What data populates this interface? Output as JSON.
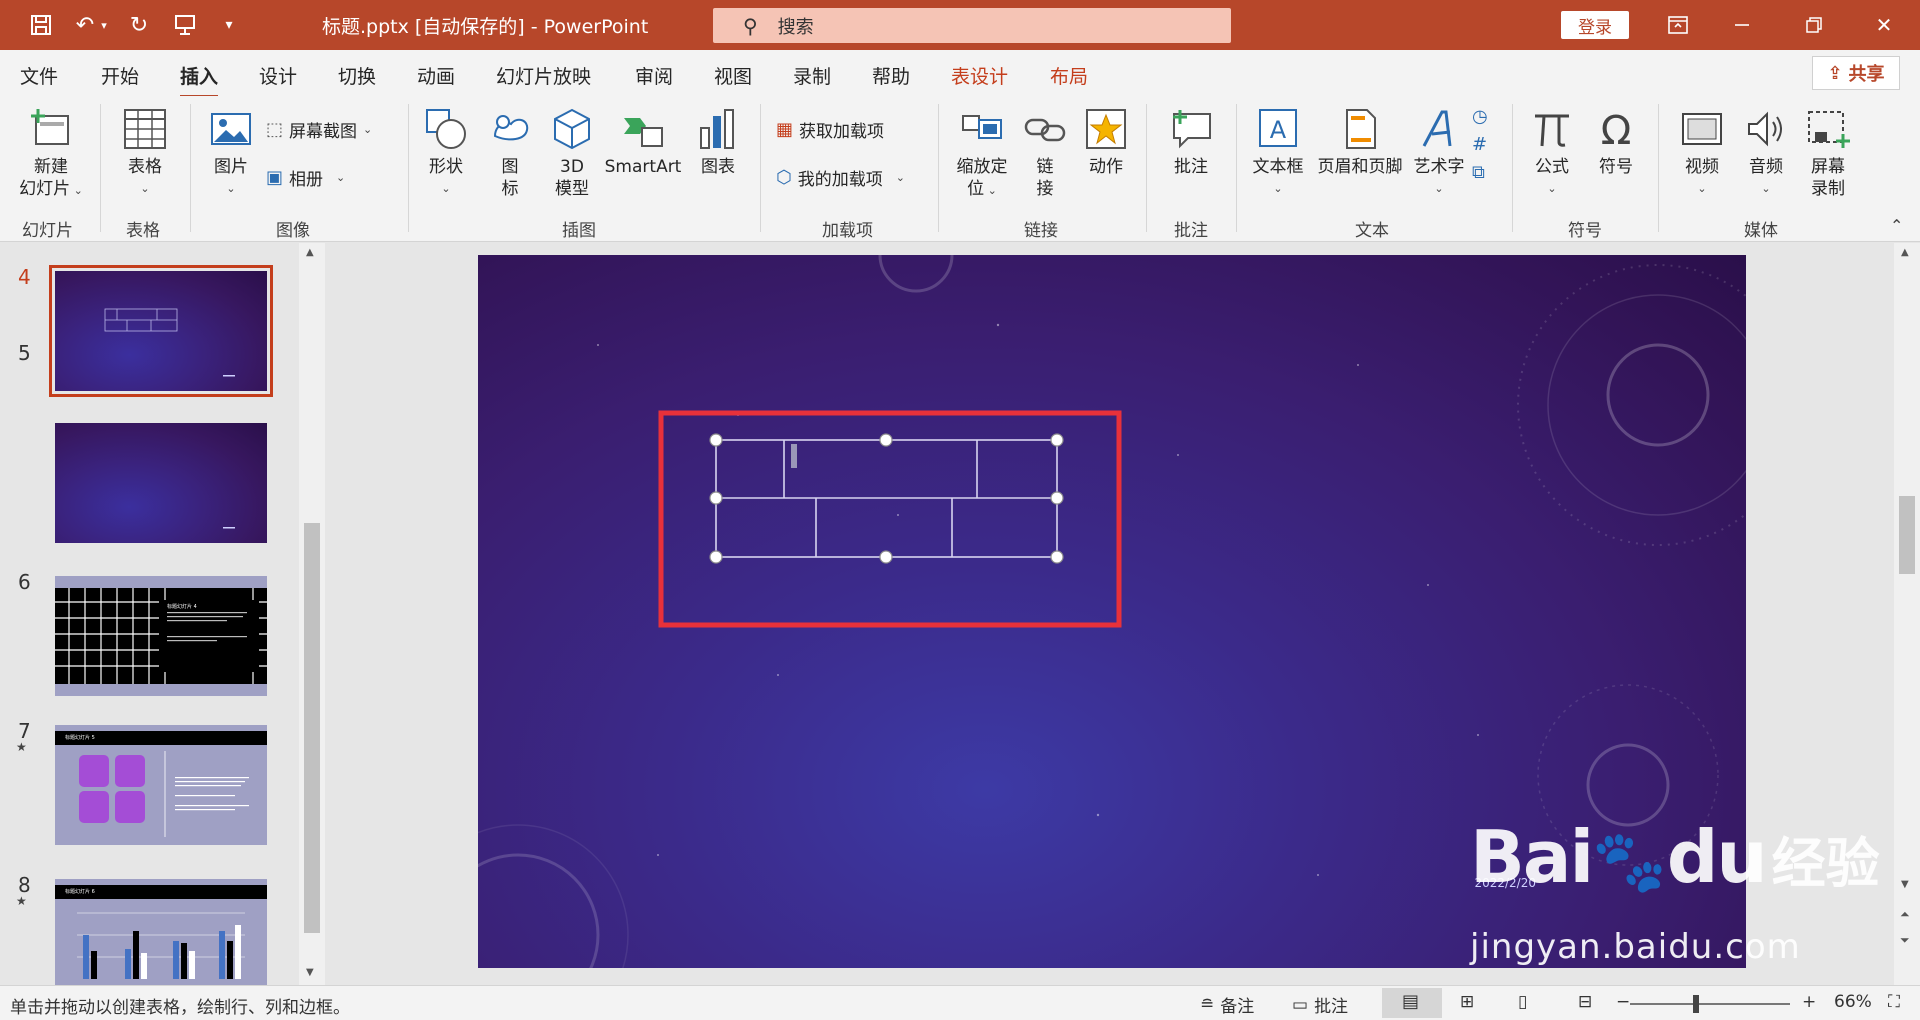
{
  "title_bar": {
    "doc_title": "标题.pptx [自动保存的]  -  PowerPoint",
    "search_placeholder": "搜索",
    "login_label": "登录"
  },
  "tabs": [
    {
      "label": "文件"
    },
    {
      "label": "开始"
    },
    {
      "label": "插入"
    },
    {
      "label": "设计"
    },
    {
      "label": "切换"
    },
    {
      "label": "动画"
    },
    {
      "label": "幻灯片放映"
    },
    {
      "label": "审阅"
    },
    {
      "label": "视图"
    },
    {
      "label": "录制"
    },
    {
      "label": "帮助"
    },
    {
      "label": "表设计"
    },
    {
      "label": "布局"
    }
  ],
  "active_tab": "插入",
  "share_label": "共享",
  "ribbon": {
    "new_slide_l1": "新建",
    "new_slide_l2": "幻灯片",
    "table": "表格",
    "picture": "图片",
    "screenshot": "屏幕截图",
    "album": "相册",
    "shapes": "形状",
    "icons_l1": "图",
    "icons_l2": "标",
    "model3d_l1": "3D",
    "model3d_l2": "模型",
    "smartart": "SmartArt",
    "chart": "图表",
    "get_addins": "获取加载项",
    "my_addins": "我的加载项",
    "zoom_l1": "缩放定",
    "zoom_l2": "位",
    "link_l1": "链",
    "link_l2": "接",
    "action": "动作",
    "comment": "批注",
    "textbox": "文本框",
    "header_footer": "页眉和页脚",
    "wordart": "艺术字",
    "equation": "公式",
    "symbol": "符号",
    "video": "视频",
    "audio": "音频",
    "screen_rec_l1": "屏幕",
    "screen_rec_l2": "录制",
    "groups": {
      "slides": "幻灯片",
      "tables": "表格",
      "images": "图像",
      "illustrations": "插图",
      "addins": "加载项",
      "links": "链接",
      "comments": "批注",
      "text": "文本",
      "symbols": "符号",
      "media": "媒体"
    }
  },
  "thumbnails": [
    {
      "num": "4",
      "selected": true
    },
    {
      "num": "5"
    },
    {
      "num": "6",
      "title": "标题幻灯片 4"
    },
    {
      "num": "7",
      "title": "标题幻灯片 5"
    },
    {
      "num": "8",
      "title": "标题幻灯片 6"
    }
  ],
  "slide": {
    "date": "2022/2/20"
  },
  "status": {
    "hint": "单击并拖动以创建表格，绘制行、列和边框。",
    "notes": "备注",
    "comments": "批注",
    "zoom": "66%"
  },
  "watermark": {
    "brand": "Bai",
    "brand2": "du",
    "cn": "经验",
    "url": "jingyan.baidu.com"
  },
  "colors": {
    "accent": "#b7472a",
    "selection_box": "#e8313a"
  }
}
